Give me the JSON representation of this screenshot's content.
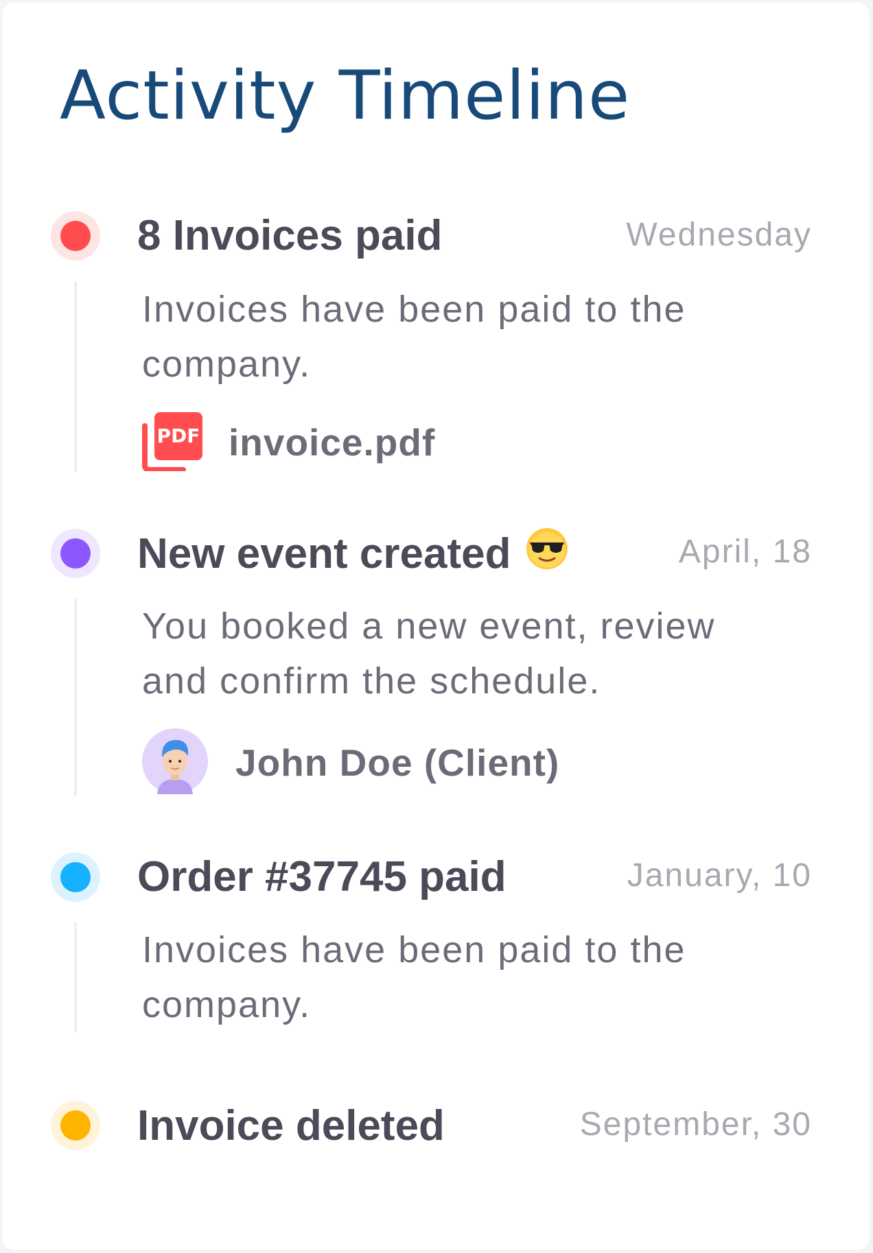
{
  "card": {
    "title": "Activity Timeline"
  },
  "colors": {
    "title": "#184a79",
    "red": "#ff4d4f",
    "purple": "#8c57ff",
    "blue": "#16b1ff",
    "orange": "#ffb400"
  },
  "events": [
    {
      "title": "8 Invoices paid",
      "date": "Wednesday",
      "description": "Invoices have been paid to the company.",
      "attachment": {
        "icon": "pdf-file-icon",
        "icon_text": "PDF",
        "label": "invoice.pdf"
      },
      "dot_color": "red"
    },
    {
      "title": "New event created",
      "title_icon": "sunglasses-emoji",
      "date": "April, 18",
      "description": "You booked a new event, review and confirm the schedule.",
      "attachment": {
        "icon": "avatar",
        "label": "John Doe (Client)"
      },
      "dot_color": "purple"
    },
    {
      "title": "Order #37745 paid",
      "date": "January, 10",
      "description": "Invoices have been paid to the company.",
      "dot_color": "blue"
    },
    {
      "title": "Invoice deleted",
      "date": "September, 30",
      "dot_color": "orange"
    }
  ]
}
